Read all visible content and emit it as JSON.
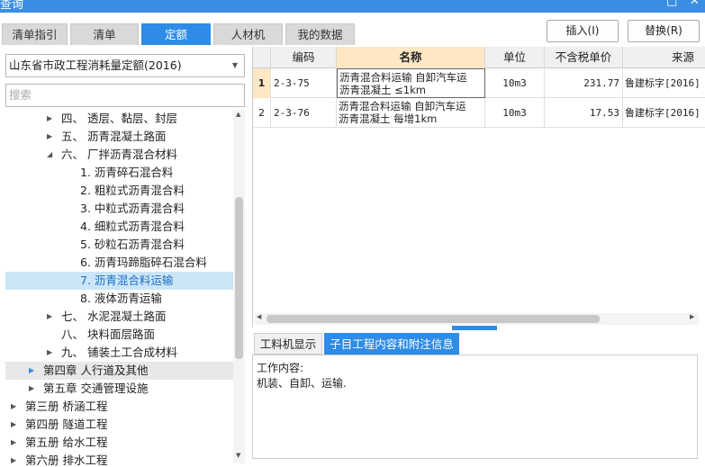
{
  "window": {
    "title": "查询",
    "win_glyph": "□",
    "close_glyph": "✕"
  },
  "tabs": [
    {
      "label": "清单指引",
      "active": false
    },
    {
      "label": "清单",
      "active": false
    },
    {
      "label": "定额",
      "active": true
    },
    {
      "label": "人材机",
      "active": false
    },
    {
      "label": "我的数据",
      "active": false
    }
  ],
  "toolbar": {
    "insert_label": "插入(I)",
    "replace_label": "替换(R)"
  },
  "quota_library": {
    "selected": "山东省市政工程消耗量定额(2016)"
  },
  "search": {
    "placeholder": "搜索",
    "value": ""
  },
  "tree": [
    {
      "label": "四、 透层、黏层、封层",
      "level": 2,
      "caret": "collapsed"
    },
    {
      "label": "五、 沥青混凝土路面",
      "level": 2,
      "caret": "collapsed"
    },
    {
      "label": "六、 厂拌沥青混合材料",
      "level": 2,
      "caret": "expanded"
    },
    {
      "label": "1. 沥青碎石混合料",
      "level": 3,
      "caret": "none"
    },
    {
      "label": "2. 粗粒式沥青混合料",
      "level": 3,
      "caret": "none"
    },
    {
      "label": "3. 中粒式沥青混合料",
      "level": 3,
      "caret": "none"
    },
    {
      "label": "4. 细粒式沥青混合料",
      "level": 3,
      "caret": "none"
    },
    {
      "label": "5. 砂粒石沥青混合料",
      "level": 3,
      "caret": "none"
    },
    {
      "label": "6. 沥青玛蹄脂碎石混合料",
      "level": 3,
      "caret": "none"
    },
    {
      "label": "7. 沥青混合料运输",
      "level": 3,
      "caret": "none",
      "selected": true
    },
    {
      "label": "8. 液体沥青运输",
      "level": 3,
      "caret": "none"
    },
    {
      "label": "七、 水泥混凝土路面",
      "level": 2,
      "caret": "collapsed"
    },
    {
      "label": "八、 块料面层路面",
      "level": 2,
      "caret": "none"
    },
    {
      "label": "九、 铺装土工合成材料",
      "level": 2,
      "caret": "collapsed"
    },
    {
      "label": "第四章 人行道及其他",
      "level": 1,
      "caret": "collapsed-blue",
      "chapter": true
    },
    {
      "label": "第五章 交通管理设施",
      "level": 1,
      "caret": "collapsed"
    },
    {
      "label": "第三册 桥涵工程",
      "level": 0,
      "caret": "collapsed"
    },
    {
      "label": "第四册 隧道工程",
      "level": 0,
      "caret": "collapsed"
    },
    {
      "label": "第五册 给水工程",
      "level": 0,
      "caret": "collapsed"
    },
    {
      "label": "第六册 排水工程",
      "level": 0,
      "caret": "collapsed"
    }
  ],
  "grid": {
    "columns": [
      "编码",
      "名称",
      "单位",
      "不含税单价",
      "来源"
    ],
    "rows": [
      {
        "num": "1",
        "code": "2-3-75",
        "name_line1": "沥青混合料运输 自卸汽车运",
        "name_line2": "沥青混凝土 ≤1km",
        "unit": "10m3",
        "price": "231.77",
        "source": "鲁建标字[2016]"
      },
      {
        "num": "2",
        "code": "2-3-76",
        "name_line1": "沥青混合料运输 自卸汽车运",
        "name_line2": "沥青混凝土 每增1km",
        "unit": "10m3",
        "price": "17.53",
        "source": "鲁建标字[2016]"
      }
    ]
  },
  "bottom_tabs": [
    {
      "label": "工料机显示",
      "active": false
    },
    {
      "label": "子目工程内容和附注信息",
      "active": true
    }
  ],
  "work_content": {
    "heading": "工作内容:",
    "text": "机装、自卸、运输."
  },
  "icons": {
    "caret_collapsed": "▶",
    "caret_expanded": "◢",
    "dropdown_arrow": "▼",
    "scroll_up": "▲",
    "scroll_down": "▼",
    "scroll_left": "◀",
    "scroll_right": "▶"
  },
  "colors": {
    "accent": "#2e8ce6",
    "selected_row": "#cce6f8",
    "header_highlight": "#fde7c4"
  }
}
